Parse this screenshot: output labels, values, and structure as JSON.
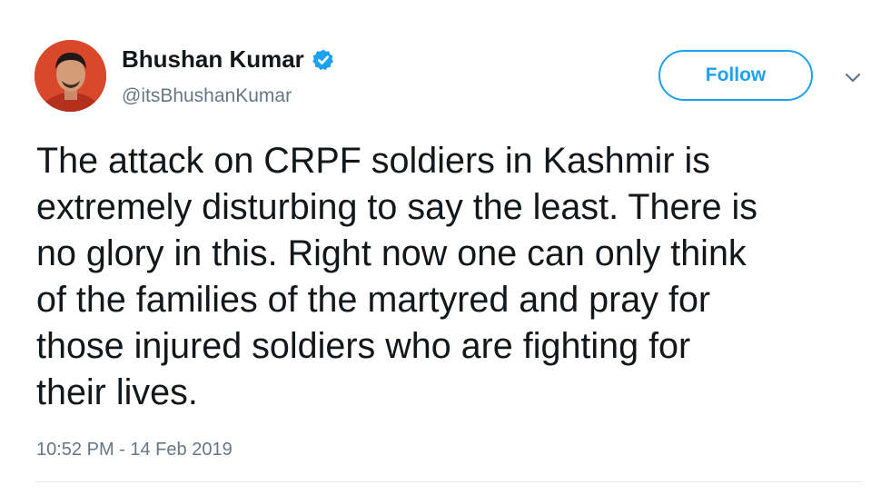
{
  "author": {
    "display_name": "Bhushan Kumar",
    "handle": "@itsBhushanKumar",
    "verified": true
  },
  "follow_button": {
    "label": "Follow"
  },
  "tweet": {
    "text": "The attack on CRPF soldiers in Kashmir is\nextremely disturbing to say the least. There is\nno glory in this. Right now one can only think\nof the families of the martyred and pray for\nthose injured soldiers who are fighting for\ntheir lives.",
    "timestamp": "10:52 PM - 14 Feb 2019"
  },
  "colors": {
    "accent": "#1da1f2",
    "text_primary": "#14171a",
    "text_secondary": "#657786",
    "divider": "#e6ecf0"
  },
  "icons": {
    "verified": "verified-badge-icon",
    "more": "chevron-down-icon"
  }
}
